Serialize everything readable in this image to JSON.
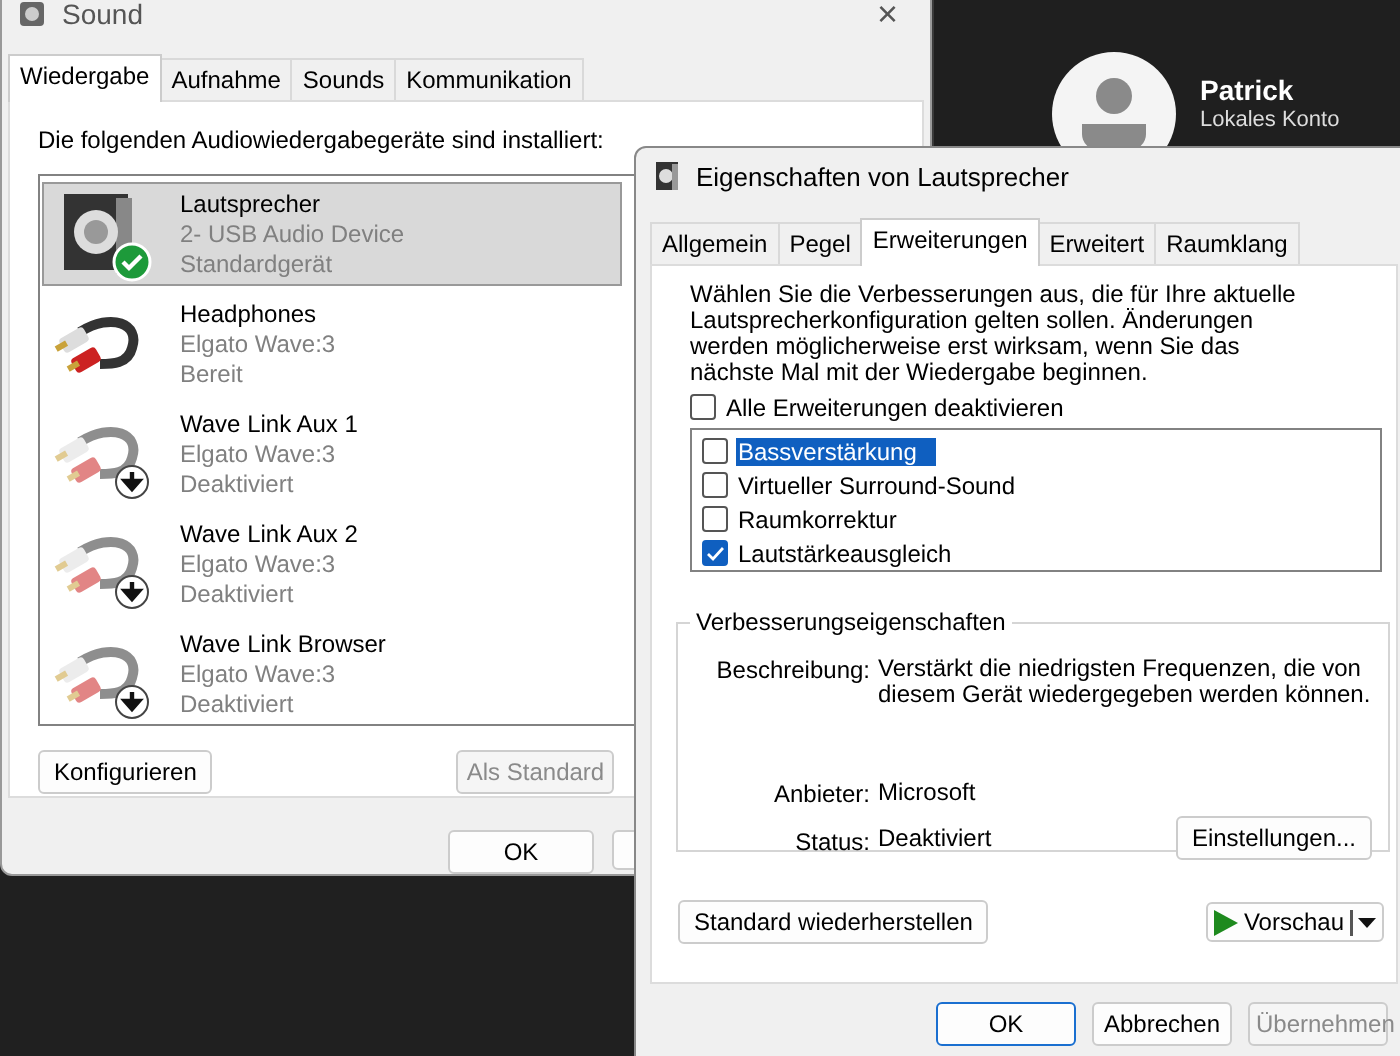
{
  "sound_window": {
    "title": "Sound",
    "close_button": "×",
    "tabs": [
      {
        "label": "Wiedergabe",
        "selected": true
      },
      {
        "label": "Aufnahme",
        "selected": false
      },
      {
        "label": "Sounds",
        "selected": false
      },
      {
        "label": "Kommunikation",
        "selected": false
      }
    ],
    "heading": "Die folgenden Audiowiedergabegeräte sind installiert:",
    "devices": [
      {
        "kind": "speaker",
        "default": true,
        "disabled": false,
        "name": "Lautsprecher",
        "device": "2- USB Audio Device",
        "status": "Standardgerät",
        "selected": true
      },
      {
        "kind": "cable",
        "default": false,
        "disabled": false,
        "name": "Headphones",
        "device": "Elgato Wave:3",
        "status": "Bereit",
        "selected": false
      },
      {
        "kind": "cable",
        "default": false,
        "disabled": true,
        "name": "Wave Link Aux 1",
        "device": "Elgato Wave:3",
        "status": "Deaktiviert",
        "selected": false
      },
      {
        "kind": "cable",
        "default": false,
        "disabled": true,
        "name": "Wave Link Aux 2",
        "device": "Elgato Wave:3",
        "status": "Deaktiviert",
        "selected": false
      },
      {
        "kind": "cable",
        "default": false,
        "disabled": true,
        "name": "Wave Link Browser",
        "device": "Elgato Wave:3",
        "status": "Deaktiviert",
        "selected": false
      }
    ],
    "configure_button": "Konfigurieren",
    "default_button": {
      "label": "Als Standard",
      "disabled": true
    },
    "ok_button": "OK"
  },
  "account_panel": {
    "name": "Patrick",
    "account_type": "Lokales Konto"
  },
  "properties_dialog": {
    "title": "Eigenschaften von Lautsprecher",
    "tabs": [
      {
        "label": "Allgemein",
        "selected": false
      },
      {
        "label": "Pegel",
        "selected": false
      },
      {
        "label": "Erweiterungen",
        "selected": true
      },
      {
        "label": "Erweitert",
        "selected": false
      },
      {
        "label": "Raumklang",
        "selected": false
      }
    ],
    "intro": "Wählen Sie die Verbesserungen aus, die für Ihre aktuelle Lautsprecherkonfiguration gelten sollen. Änderungen werden möglicherweise erst wirksam, wenn Sie das nächste Mal mit der Wiedergabe beginnen.",
    "disable_all": {
      "label": "Alle Erweiterungen deaktivieren",
      "checked": false
    },
    "enhancements": [
      {
        "label": "Bassverstärkung",
        "checked": false,
        "selected": true
      },
      {
        "label": "Virtueller Surround-Sound",
        "checked": false,
        "selected": false
      },
      {
        "label": "Raumkorrektur",
        "checked": false,
        "selected": false
      },
      {
        "label": "Lautstärkeausgleich",
        "checked": true,
        "selected": false
      }
    ],
    "group": {
      "title": "Verbesserungseigenschaften",
      "description_label": "Beschreibung:",
      "description": "Verstärkt die niedrigsten Frequenzen, die von diesem Gerät wiedergegeben werden können.",
      "provider_label": "Anbieter:",
      "provider": "Microsoft",
      "status_label": "Status:",
      "status": "Deaktiviert",
      "settings_button": "Einstellungen..."
    },
    "restore_button": "Standard wiederherstellen",
    "preview_button": "Vorschau",
    "buttons": [
      {
        "label": "OK",
        "kind": "default",
        "disabled": false
      },
      {
        "label": "Abbrechen",
        "kind": "normal",
        "disabled": false
      },
      {
        "label": "Übernehmen",
        "kind": "normal",
        "disabled": true
      }
    ]
  }
}
